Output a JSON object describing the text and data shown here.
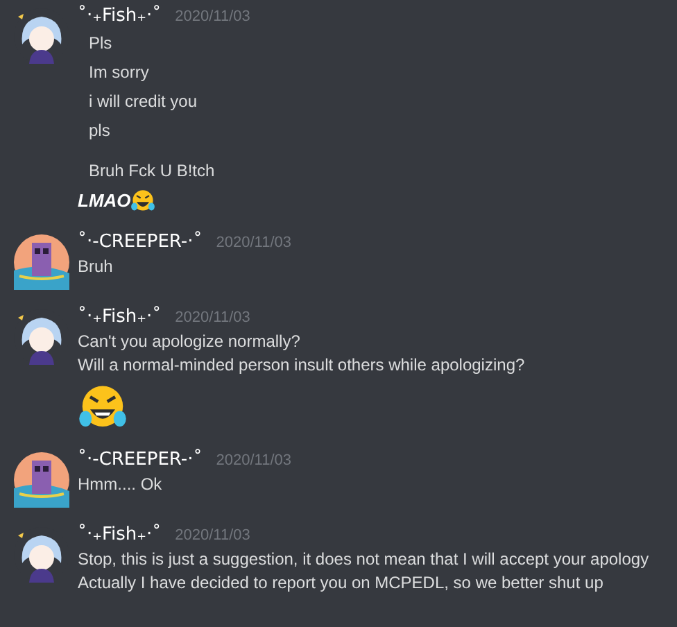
{
  "messages": [
    {
      "author": "˚‧₊Fish₊‧˚",
      "kind": "fish",
      "timestamp": "2020/11/03",
      "lines": [
        {
          "kind": "indented",
          "text": "Pls"
        },
        {
          "kind": "indented",
          "text": "Im sorry"
        },
        {
          "kind": "indented",
          "text": "i will credit you"
        },
        {
          "kind": "indented",
          "text": "pls"
        },
        {
          "kind": "gap"
        },
        {
          "kind": "indented",
          "text": "Bruh Fck U B!tch"
        },
        {
          "kind": "emphasis",
          "text": "LMAO"
        }
      ]
    },
    {
      "author": "˚‧-CREEPER-‧˚",
      "kind": "creeper",
      "timestamp": "2020/11/03",
      "lines": [
        {
          "kind": "text",
          "text": "Bruh"
        }
      ]
    },
    {
      "author": "˚‧₊Fish₊‧˚",
      "kind": "fish",
      "timestamp": "2020/11/03",
      "lines": [
        {
          "kind": "text",
          "text": "Can't you apologize normally?"
        },
        {
          "kind": "text",
          "text": "Will a normal-minded person insult others while apologizing?"
        },
        {
          "kind": "emoji"
        }
      ]
    },
    {
      "author": "˚‧-CREEPER-‧˚",
      "kind": "creeper",
      "timestamp": "2020/11/03",
      "lines": [
        {
          "kind": "text",
          "text": "Hmm.... Ok"
        }
      ]
    },
    {
      "author": "˚‧₊Fish₊‧˚",
      "kind": "fish",
      "timestamp": "2020/11/03",
      "lines": [
        {
          "kind": "text",
          "text": "Stop, this is just a suggestion, it does not mean that I will accept your apology"
        },
        {
          "kind": "text",
          "text": "Actually I have decided to report you on MCPEDL, so we better shut up"
        }
      ]
    }
  ]
}
